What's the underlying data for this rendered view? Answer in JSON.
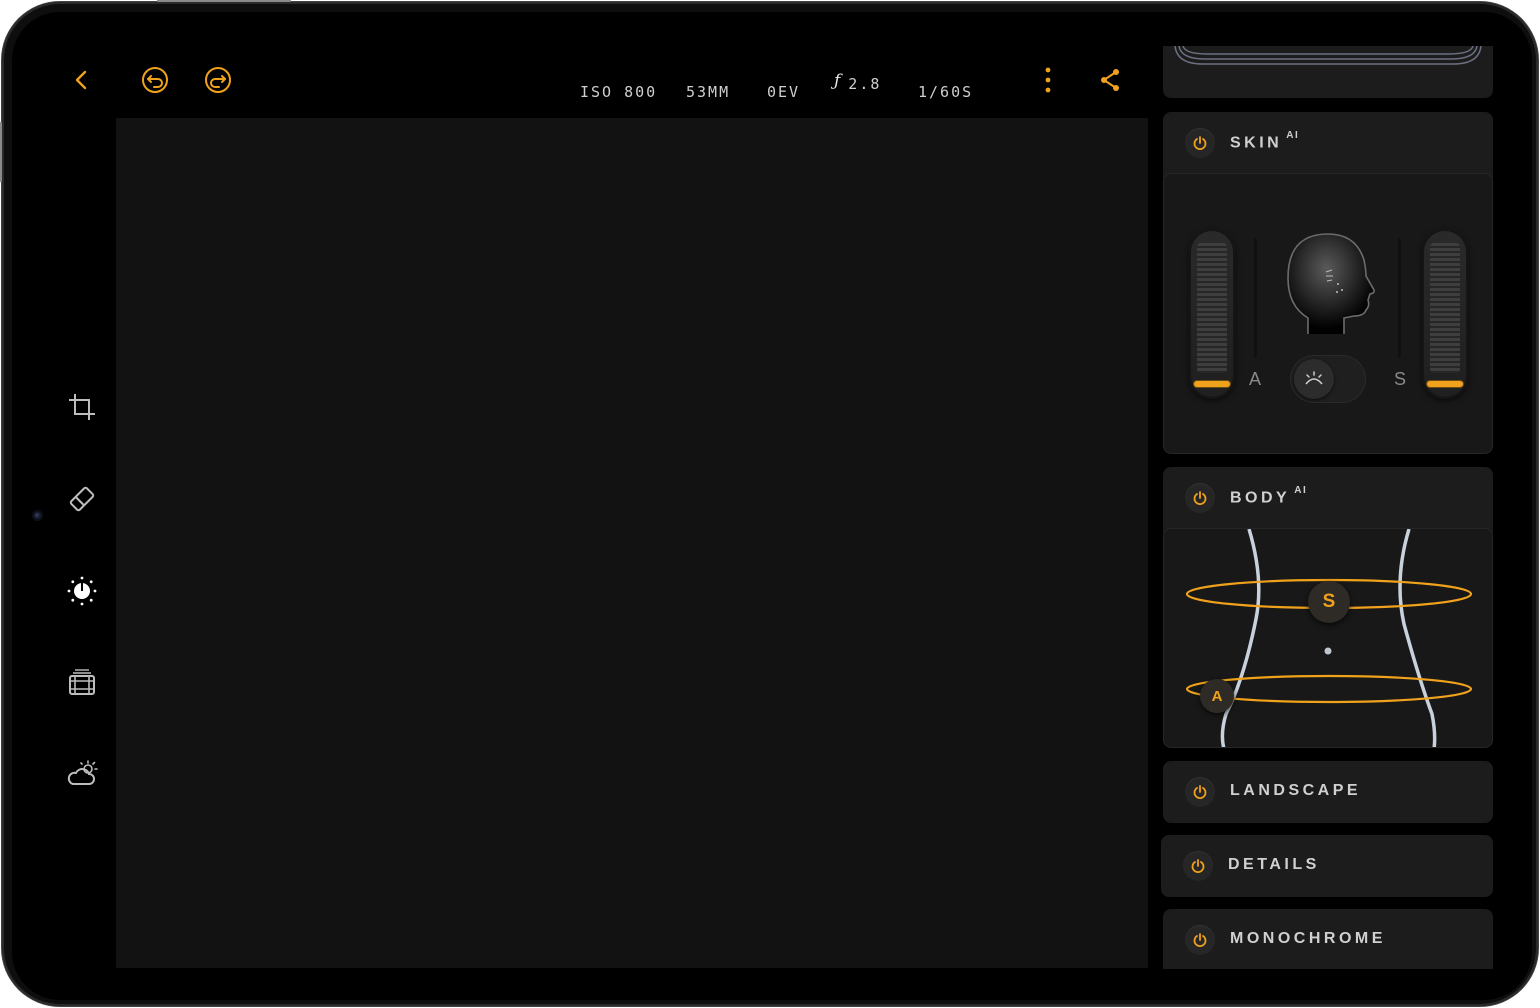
{
  "toolbar": {
    "icons": [
      "back-icon",
      "undo-icon",
      "redo-icon",
      "more-vertical-icon",
      "share-icon"
    ],
    "iso": "ISO 800",
    "focal": "53MM",
    "ev": "0EV",
    "aperture_symbol": "ƒ",
    "aperture": "2.8",
    "shutter": "1/60S"
  },
  "sidebar": {
    "tools": [
      "crop-icon",
      "eraser-icon",
      "adjust-dial-icon",
      "film-icon",
      "weather-icon"
    ],
    "active": "adjust-dial-icon"
  },
  "panels": {
    "skin": {
      "title": "SKIN",
      "badge": "AI",
      "left_label": "A",
      "right_label": "S"
    },
    "body": {
      "title": "BODY",
      "badge": "AI",
      "handle_s": "S",
      "handle_a": "A"
    },
    "landscape": {
      "title": "LANDSCAPE"
    },
    "details": {
      "title": "DETAILS"
    },
    "monochrome": {
      "title": "MONOCHROME"
    }
  },
  "colors": {
    "accent": "#f0a21c",
    "canvas": "#121212",
    "panel": "#1c1c1c"
  }
}
